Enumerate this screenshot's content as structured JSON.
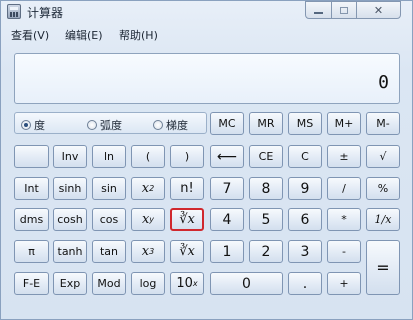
{
  "window": {
    "title": "计算器"
  },
  "menu": {
    "view": "查看(V)",
    "edit": "编辑(E)",
    "help": "帮助(H)"
  },
  "display": {
    "value": "0"
  },
  "angle_mode": {
    "degrees": "度",
    "radians": "弧度",
    "gradians": "梯度",
    "selected": "degrees"
  },
  "keys": {
    "mc": "MC",
    "mr": "MR",
    "ms": "MS",
    "mplus": "M+",
    "mminus": "M-",
    "inv": "Inv",
    "ln": "ln",
    "lparen": "(",
    "rparen": ")",
    "backspace": "⟵",
    "ce": "CE",
    "c": "C",
    "negate": "±",
    "sqrt": "√",
    "int": "Int",
    "sinh": "sinh",
    "sin": "sin",
    "x2_base": "x",
    "x2_exp": "2",
    "factorial": "n!",
    "n7": "7",
    "n8": "8",
    "n9": "9",
    "divide": "/",
    "percent": "%",
    "dms": "dms",
    "cosh": "cosh",
    "cos": "cos",
    "xy_base": "x",
    "xy_exp": "y",
    "root_y": "∛x",
    "n4": "4",
    "n5": "5",
    "n6": "6",
    "multiply": "*",
    "reciprocal": "1/x",
    "pi": "π",
    "tanh": "tanh",
    "tan": "tan",
    "x3_base": "x",
    "x3_exp": "3",
    "cbrt": "∛x",
    "n1": "1",
    "n2": "2",
    "n3": "3",
    "subtract": "-",
    "equals": "=",
    "fe": "F-E",
    "exp": "Exp",
    "mod": "Mod",
    "log": "log",
    "ten_base": "10",
    "ten_exp": "x",
    "n0": "0",
    "decimal": ".",
    "add": "+"
  },
  "colors": {
    "highlight": "#d0282e",
    "window_bg": "#dbe6f3"
  },
  "icons": {
    "app": "calculator-icon",
    "minimize": "minimize-icon",
    "maximize": "maximize-icon",
    "close": "close-icon"
  }
}
